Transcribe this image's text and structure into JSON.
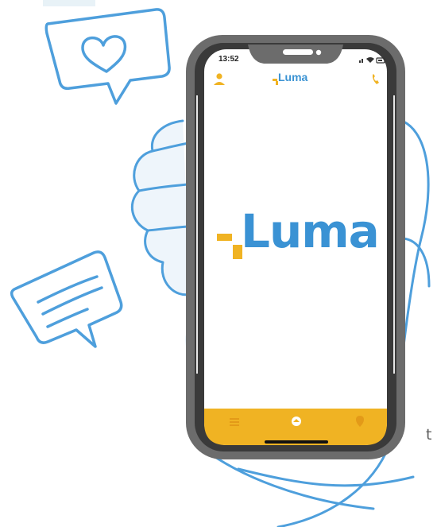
{
  "background_text": "t",
  "phone": {
    "status_bar": {
      "time": "13:52"
    },
    "header": {
      "logo_text": "Luma"
    },
    "splash": {
      "logo_text": "Luma"
    }
  },
  "icons": [
    "heart-chat-bubble-icon",
    "message-lines-bubble-icon",
    "user-icon",
    "phone-icon",
    "signal-icon",
    "wifi-icon",
    "battery-icon",
    "menu-icon",
    "home-icon",
    "location-icon"
  ],
  "colors": {
    "brand_blue": "#3a92d4",
    "brand_orange": "#f0b323",
    "line_blue": "#4e9fdc",
    "phone_frame": "#6c6c6c",
    "tab_bar": "#f0b323"
  }
}
